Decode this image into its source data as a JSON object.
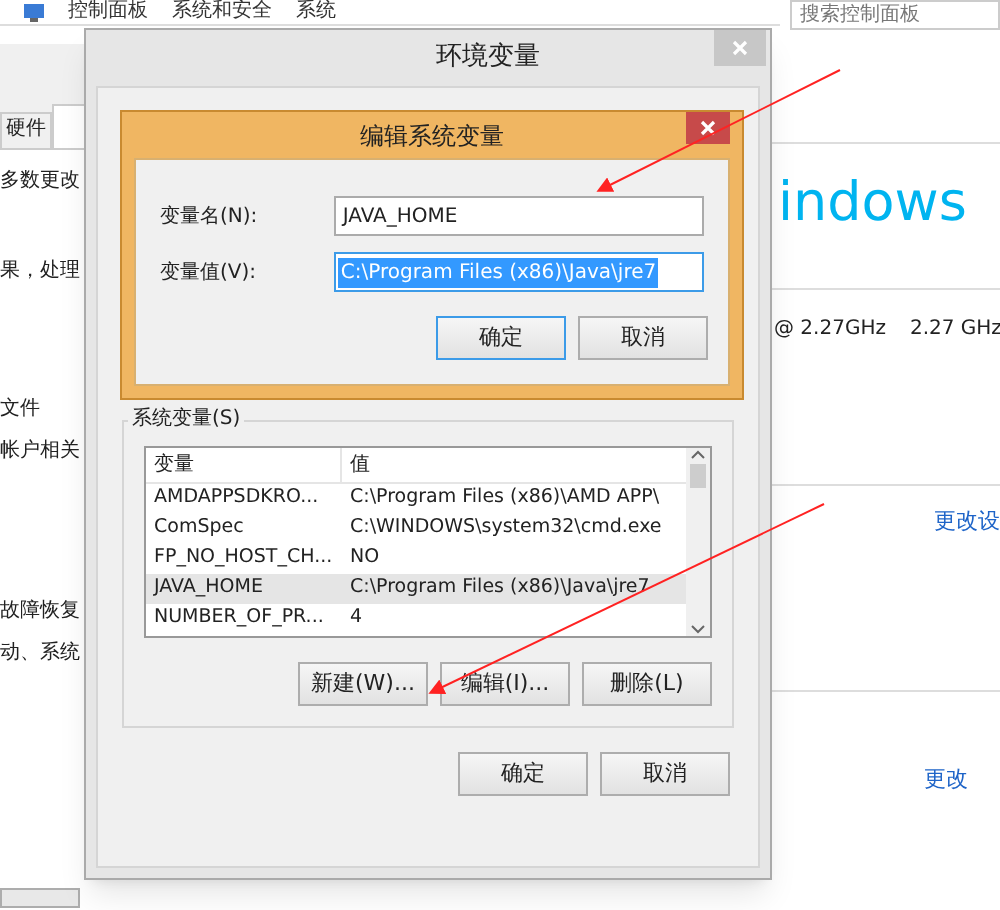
{
  "breadcrumb": [
    "控制面板",
    "系统和安全",
    "系统"
  ],
  "search": {
    "placeholder": "搜索控制面板"
  },
  "system_properties": {
    "tabs": [
      {
        "label": "硬件",
        "selected": false
      },
      {
        "selected": true
      }
    ],
    "lines": [
      "多数更改",
      "果，处理",
      "文件",
      "帐户相关",
      "故障恢复",
      "动、系统"
    ]
  },
  "system_info": {
    "logo_text": "indows",
    "processor": "@ 2.27GHz",
    "speed": "2.27 GHz",
    "change_settings": "更改设",
    "change_link": "更改"
  },
  "env_dialog": {
    "title": "环境变量",
    "system_group": "系统变量(S)",
    "columns": [
      "变量",
      "值"
    ],
    "rows": [
      {
        "name": "AMDAPPSDKRO...",
        "value": "C:\\Program Files (x86)\\AMD APP\\",
        "selected": false
      },
      {
        "name": "ComSpec",
        "value": "C:\\WINDOWS\\system32\\cmd.exe",
        "selected": false
      },
      {
        "name": "FP_NO_HOST_CH...",
        "value": "NO",
        "selected": false
      },
      {
        "name": "JAVA_HOME",
        "value": "C:\\Program Files (x86)\\Java\\jre7",
        "selected": true
      },
      {
        "name": "NUMBER_OF_PR...",
        "value": "4",
        "selected": false
      }
    ],
    "list_buttons": [
      "新建(W)...",
      "编辑(I)...",
      "删除(L)"
    ],
    "buttons": [
      "确定",
      "取消"
    ]
  },
  "edit_dialog": {
    "title": "编辑系统变量",
    "name_label": "变量名(N):",
    "name_value": "JAVA_HOME",
    "value_label": "变量值(V):",
    "value_value": "C:\\Program Files (x86)\\Java\\jre7",
    "value_selected": true,
    "buttons": [
      {
        "label": "确定",
        "focused": true
      },
      {
        "label": "取消",
        "focused": false
      }
    ]
  }
}
